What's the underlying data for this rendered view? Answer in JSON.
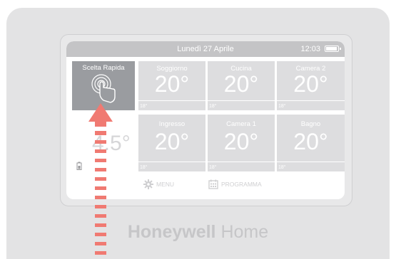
{
  "status": {
    "date": "Lunedì 27 Aprile",
    "time": "12:03",
    "battery_level": 1.0
  },
  "quick_select": {
    "label": "Scelta Rapida",
    "icon": "touch-hand-icon"
  },
  "outside": {
    "temp": "4.5°",
    "icon": "battery-low-icon"
  },
  "zones": [
    {
      "name": "Soggiorno",
      "temp": "20°",
      "setpoint": "18°"
    },
    {
      "name": "Cucina",
      "temp": "20°",
      "setpoint": "18°"
    },
    {
      "name": "Camera 2",
      "temp": "20°",
      "setpoint": "18°"
    },
    {
      "name": "Ingresso",
      "temp": "20°",
      "setpoint": "18°"
    },
    {
      "name": "Camera 1",
      "temp": "20°",
      "setpoint": "18°"
    },
    {
      "name": "Bagno",
      "temp": "20°",
      "setpoint": "18°"
    }
  ],
  "bottom_menu": {
    "menu_label": "MENU",
    "program_label": "PROGRAMMA"
  },
  "brand": {
    "bold": "Honeywell",
    "light": " Home"
  },
  "annotation": {
    "arrow_color": "#f07a72",
    "direction": "up"
  }
}
